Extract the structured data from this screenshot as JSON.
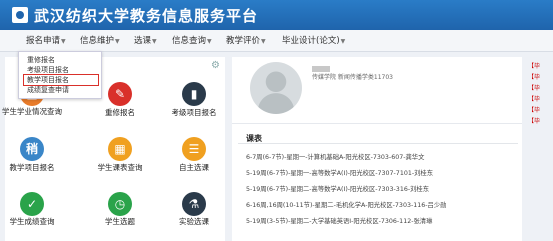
{
  "site": {
    "title": "武汉纺织大学教务信息服务平台"
  },
  "nav": [
    {
      "label": "报名申请"
    },
    {
      "label": "信息维护"
    },
    {
      "label": "选课"
    },
    {
      "label": "信息查询"
    },
    {
      "label": "教学评价"
    },
    {
      "label": "毕业设计(论文)"
    }
  ],
  "dropdown": [
    {
      "label": "重修报名"
    },
    {
      "label": "考级项目报名"
    },
    {
      "label": "教学项目报名"
    },
    {
      "label": "成绩复查申请"
    }
  ],
  "tiles": [
    {
      "label": "学生学业情况查询",
      "icon": "stats-icon",
      "color": "#e87b2a"
    },
    {
      "label": "重修报名",
      "icon": "retake-icon",
      "color": "#d9302a"
    },
    {
      "label": "考级项目报名",
      "icon": "book-icon",
      "color": "#2a3a4a"
    },
    {
      "label": "教学项目报名",
      "icon": "register-icon",
      "color": "#3a86c8"
    },
    {
      "label": "学生课表查询",
      "icon": "schedule-icon",
      "color": "#f0a020"
    },
    {
      "label": "自主选课",
      "icon": "course-select-icon",
      "color": "#f0a020"
    },
    {
      "label": "学生成绩查询",
      "icon": "grades-icon",
      "color": "#2aa34a"
    },
    {
      "label": "学生选题",
      "icon": "topic-icon",
      "color": "#2aa34a"
    },
    {
      "label": "实验选课",
      "icon": "lab-icon",
      "color": "#2a3a4a"
    }
  ],
  "profile": {
    "info": "传媒学院 新闻传播学类11703"
  },
  "timetable": {
    "title": "课表",
    "rows": [
      "6-7周(6-7节)-星期一-计算机基础A-阳光校区-7303-607-龚华文",
      "5-19周(6-7节)-星期一-高等数学A(Ⅰ)-阳光校区-7307-7101-刘桂东",
      "5-19周(6-7节)-星期二-高等数学A(Ⅰ)-阳光校区-7303-316-刘桂东",
      "6-16周,16周(10-11节)-星期二-毛机化学A-阳光校区-7303-116-吕少勋",
      "5-19周(3-5节)-星期二-大学基础英语Ⅰ-阳光校区-7306-112-张清琳"
    ]
  },
  "notices": [
    "【毕",
    "【毕",
    "【毕",
    "【毕",
    "【毕",
    "【毕"
  ]
}
